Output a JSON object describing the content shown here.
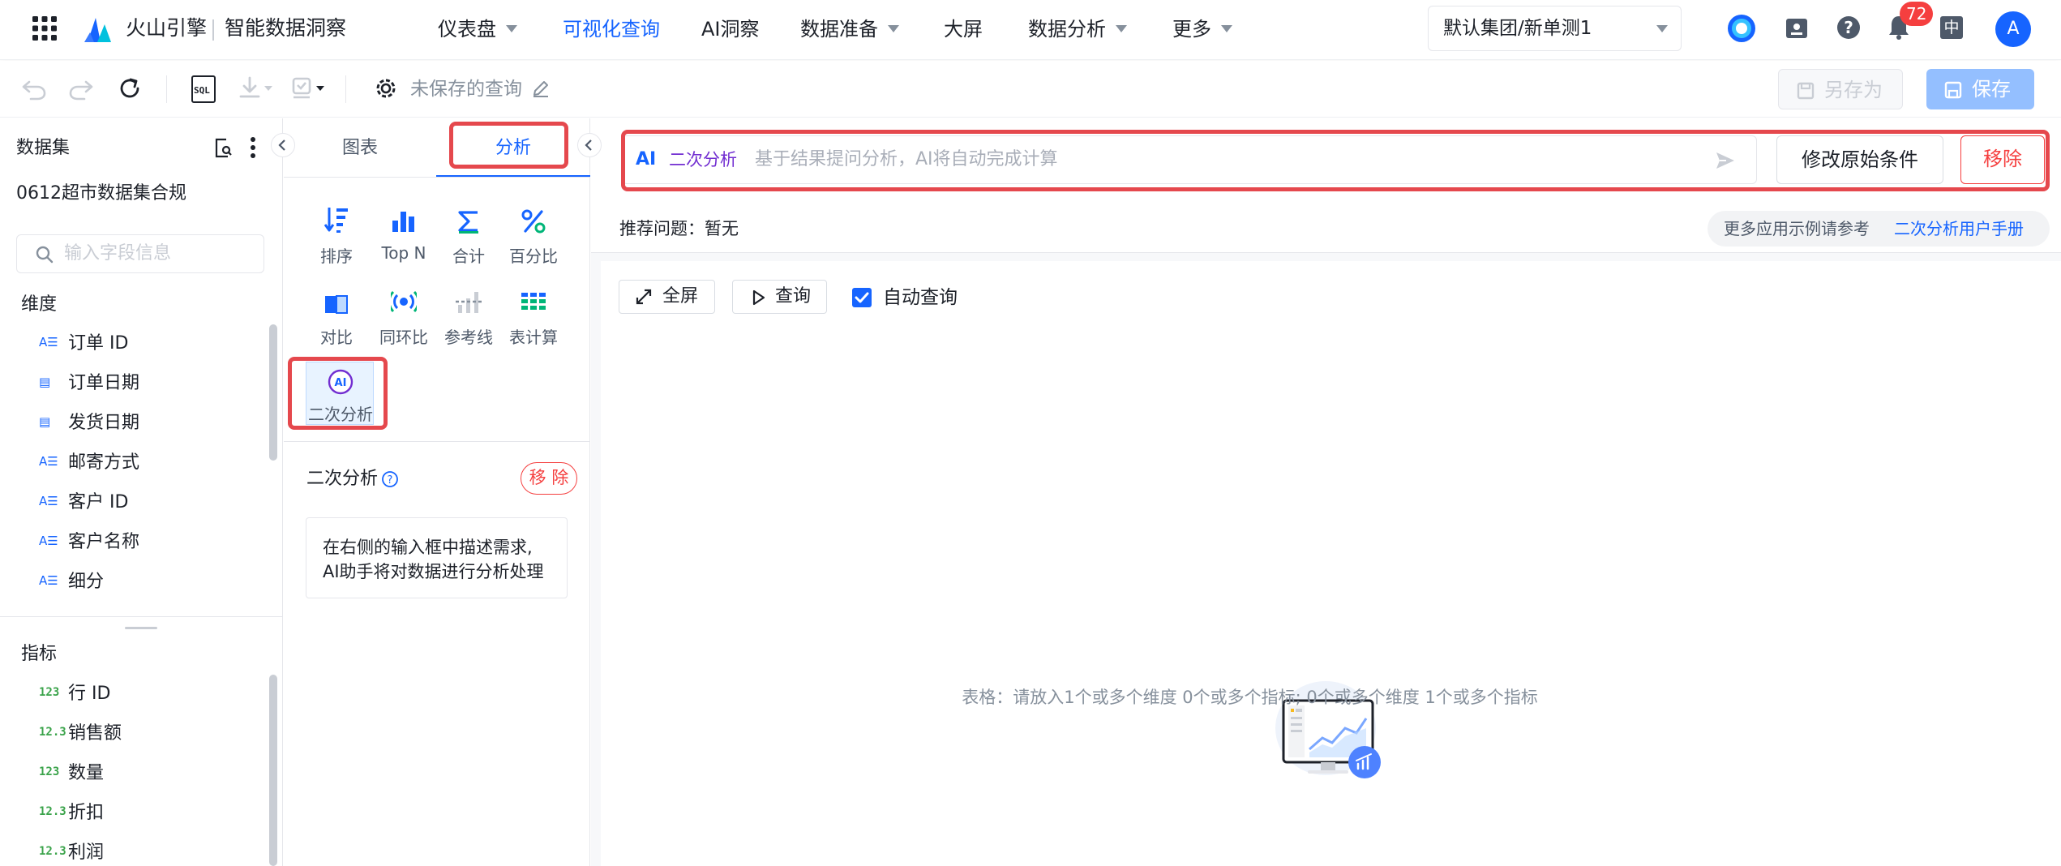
{
  "topbar": {
    "brand": "火山引擎",
    "product": "智能数据洞察",
    "nav": [
      {
        "label": "仪表盘",
        "has_caret": true
      },
      {
        "label": "可视化查询",
        "has_caret": false,
        "active": true
      },
      {
        "label": "AI洞察",
        "has_caret": false
      },
      {
        "label": "数据准备",
        "has_caret": true
      },
      {
        "label": "大屏",
        "has_caret": false
      },
      {
        "label": "数据分析",
        "has_caret": true
      },
      {
        "label": "更多",
        "has_caret": true
      }
    ],
    "org_select": "默认集团/新单测1",
    "notification_count": "72",
    "lang": "中",
    "avatar": "A"
  },
  "toolbar": {
    "sql_label": "SQL",
    "query_name": "未保存的查询",
    "save_as": "另存为",
    "save": "保存"
  },
  "dataset": {
    "title": "数据集",
    "name": "0612超市数据集合规",
    "search_placeholder": "输入字段信息",
    "dimensions_title": "维度",
    "dimensions": [
      {
        "label": "订单 ID",
        "icon": "text-field-icon"
      },
      {
        "label": "订单日期",
        "icon": "date-field-icon"
      },
      {
        "label": "发货日期",
        "icon": "date-field-icon"
      },
      {
        "label": "邮寄方式",
        "icon": "text-field-icon"
      },
      {
        "label": "客户 ID",
        "icon": "text-field-icon"
      },
      {
        "label": "客户名称",
        "icon": "text-field-icon"
      },
      {
        "label": "细分",
        "icon": "text-field-icon"
      }
    ],
    "measures_title": "指标",
    "measures": [
      {
        "label": "行 ID",
        "icon_text": "123"
      },
      {
        "label": "销售额",
        "icon_text": "12.3"
      },
      {
        "label": "数量",
        "icon_text": "123"
      },
      {
        "label": "折扣",
        "icon_text": "12.3"
      },
      {
        "label": "利润",
        "icon_text": "12.3"
      }
    ]
  },
  "analysis": {
    "tabs": [
      {
        "label": "图表"
      },
      {
        "label": "分析",
        "active": true
      }
    ],
    "tools": [
      {
        "label": "排序",
        "icon": "sort-icon"
      },
      {
        "label": "Top N",
        "icon": "bar-chart-icon"
      },
      {
        "label": "合计",
        "icon": "sigma-icon"
      },
      {
        "label": "百分比",
        "icon": "percent-icon"
      },
      {
        "label": "对比",
        "icon": "compare-icon"
      },
      {
        "label": "同环比",
        "icon": "radar-icon"
      },
      {
        "label": "参考线",
        "icon": "reference-line-icon"
      },
      {
        "label": "表计算",
        "icon": "table-calc-icon"
      },
      {
        "label": "二次分析",
        "icon": "ai-icon"
      }
    ],
    "section_title": "二次分析",
    "remove_label": "移 除",
    "hint_line1": "在右侧的输入框中描述需求,",
    "hint_line2": "AI助手将对数据进行分析处理"
  },
  "ai_bar": {
    "badge": "AI",
    "mode": "二次分析",
    "placeholder": "基于结果提问分析，AI将自动完成计算",
    "modify_button": "修改原始条件",
    "remove_button": "移除",
    "recommend_label": "推荐问题：",
    "recommend_value": "暂无",
    "manual_prefix": "更多应用示例请参考",
    "manual_link": "二次分析用户手册"
  },
  "canvas": {
    "fullscreen": "全屏",
    "query": "查询",
    "auto_query": "自动查询",
    "auto_query_checked": true,
    "empty_text": "表格：请放入1个或多个维度 0个或多个指标; 0个或多个维度 1个或多个指标"
  },
  "colors": {
    "brand_blue": "#1664ff",
    "highlight_red": "#e5484d",
    "measure_green": "#3aa34a"
  }
}
